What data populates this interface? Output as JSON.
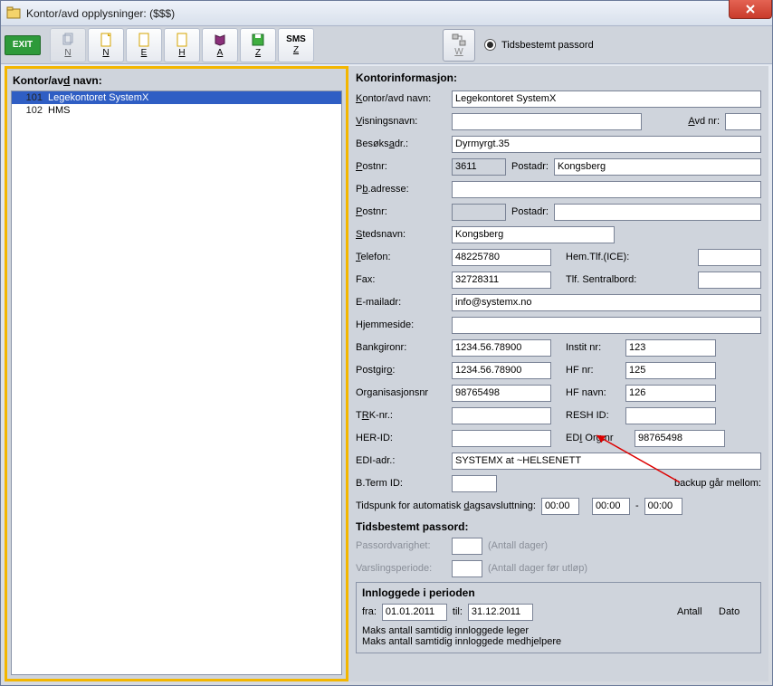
{
  "window": {
    "title": "Kontor/avd opplysninger: ($$$)"
  },
  "toolbar": {
    "exit": "EXIT",
    "btn_n": "N",
    "btn_e": "E",
    "btn_h": "H",
    "btn_a": "A",
    "btn_z": "Z",
    "btn_sms": "SMS",
    "btn_w": "W",
    "radio_label": "Tidsbestemt passord"
  },
  "left": {
    "heading": "Kontor/avd navn:",
    "rows": [
      {
        "id": "101",
        "name": "Legekontoret SystemX",
        "selected": true
      },
      {
        "id": "102",
        "name": "HMS",
        "selected": false
      }
    ]
  },
  "info": {
    "heading": "Kontorinformasjon:",
    "labels": {
      "kontor_navn": "Kontor/avd navn:",
      "visningsnavn": "Visningsnavn:",
      "avd_nr": "Avd nr:",
      "besoksadr": "Besøksadr.:",
      "postnr": "Postnr:",
      "postadr": "Postadr:",
      "pb_adresse": "Pb.adresse:",
      "postnr2": "Postnr:",
      "postadr2": "Postadr:",
      "stedsnavn": "Stedsnavn:",
      "telefon": "Telefon:",
      "hem_tlf": "Hem.Tlf.(ICE):",
      "fax": "Fax:",
      "tlf_sentralbord": "Tlf. Sentralbord:",
      "email": "E-mailadr:",
      "hjemmeside": "Hjemmeside:",
      "bankgironr": "Bankgironr:",
      "instit_nr": "Instit nr:",
      "postgiro": "Postgiro:",
      "hf_nr": "HF nr:",
      "orgnr": "Organisasjonsnr",
      "hf_navn": "HF navn:",
      "trk_nr": "TRK-nr.:",
      "resh_id": "RESH ID:",
      "her_id": "HER-ID:",
      "edi_orgnr": "EDI Org.nr",
      "edi_adr": "EDI-adr.:",
      "bterm_id": "B.Term ID:",
      "backup_label": "backup går mellom:",
      "tidspunkt": "Tidspunk for automatisk dagsavsluttning:",
      "between_sep": "-"
    },
    "values": {
      "kontor_navn": "Legekontoret SystemX",
      "visningsnavn": "",
      "avd_nr": "",
      "besoksadr": "Dyrmyrgt.35",
      "postnr": "3611",
      "postadr": "Kongsberg",
      "pb_adresse": "",
      "postnr2": "",
      "postadr2": "",
      "stedsnavn": "Kongsberg",
      "telefon": "48225780",
      "hem_tlf": "",
      "fax": "32728311",
      "tlf_sentralbord": "",
      "email": "info@systemx.no",
      "hjemmeside": "",
      "bankgironr": "1234.56.78900",
      "instit_nr": "123",
      "postgiro": "1234.56.78900",
      "hf_nr": "125",
      "orgnr": "98765498",
      "hf_navn": "126",
      "trk_nr": "",
      "resh_id": "",
      "her_id": "",
      "edi_orgnr": "98765498",
      "edi_adr": "SYSTEMX at ~HELSENETT",
      "bterm_id": "",
      "daily_time": "00:00",
      "backup_from": "00:00",
      "backup_to": "00:00"
    }
  },
  "passord": {
    "heading": "Tidsbestemt passord:",
    "varighet_label": "Passordvarighet:",
    "varighet_hint": "(Antall dager)",
    "varsling_label": "Varslingsperiode:",
    "varsling_hint": "(Antall dager før utløp)"
  },
  "period": {
    "heading": "Innloggede i perioden",
    "fra_label": "fra:",
    "fra_value": "01.01.2011",
    "til_label": "til:",
    "til_value": "31.12.2011",
    "antall_label": "Antall",
    "dato_label": "Dato",
    "row1": "Maks antall samtidig innloggede leger",
    "row2": "Maks antall samtidig innloggede medhjelpere"
  }
}
